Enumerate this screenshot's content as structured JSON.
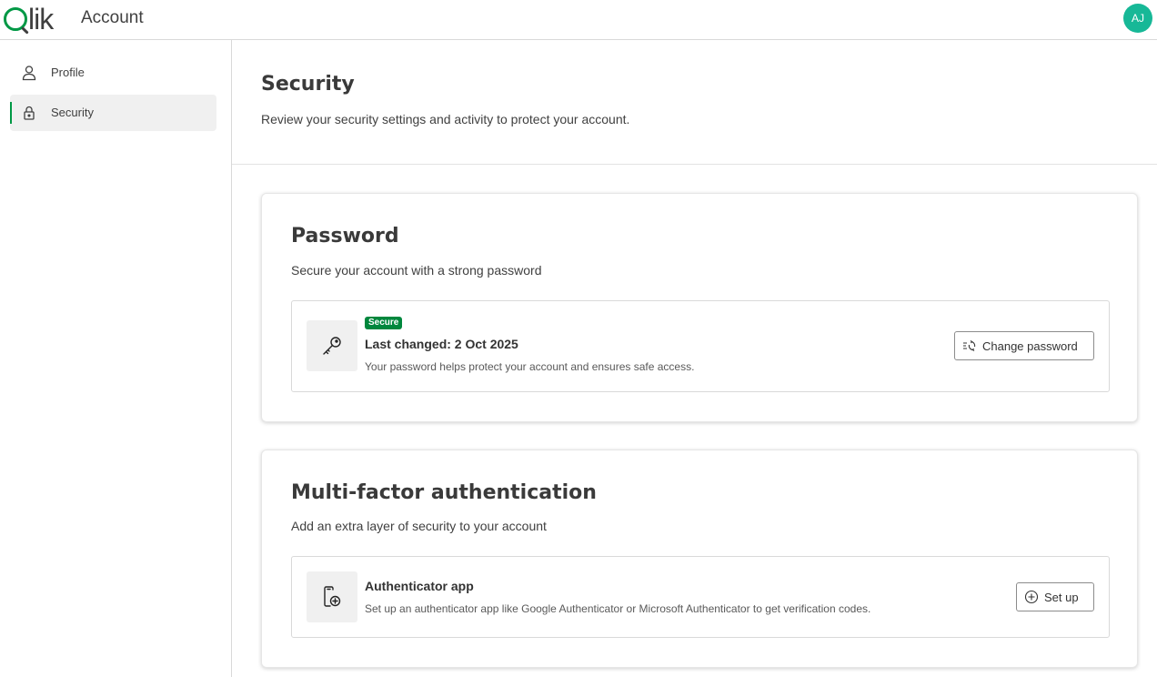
{
  "header": {
    "logo_text": "lik",
    "app_title": "Account",
    "avatar_initials": "AJ",
    "avatar_color": "#17b897"
  },
  "sidebar": {
    "items": [
      {
        "label": "Profile",
        "icon": "person-icon",
        "active": false
      },
      {
        "label": "Security",
        "icon": "lock-icon",
        "active": true
      }
    ]
  },
  "page": {
    "title": "Security",
    "subtitle": "Review your security settings and activity to protect your account."
  },
  "password_card": {
    "title": "Password",
    "subtitle": "Secure your account with a strong password",
    "badge": "Secure",
    "badge_color": "#00873d",
    "item_title": "Last changed: 2 Oct 2025",
    "item_desc": "Your password helps protect your account and ensures safe access.",
    "icon": "key-icon",
    "button_label": "Change password",
    "button_icon": "change-password-icon"
  },
  "mfa_card": {
    "title": "Multi-factor authentication",
    "subtitle": "Add an extra layer of security to your account",
    "item_title": "Authenticator app",
    "item_desc": "Set up an authenticator app like Google Authenticator or Microsoft Authenticator to get verification codes.",
    "icon": "mobile-add-icon",
    "button_label": "Set up",
    "button_icon": "plus-circle-icon"
  },
  "colors": {
    "brand_green": "#009845"
  }
}
